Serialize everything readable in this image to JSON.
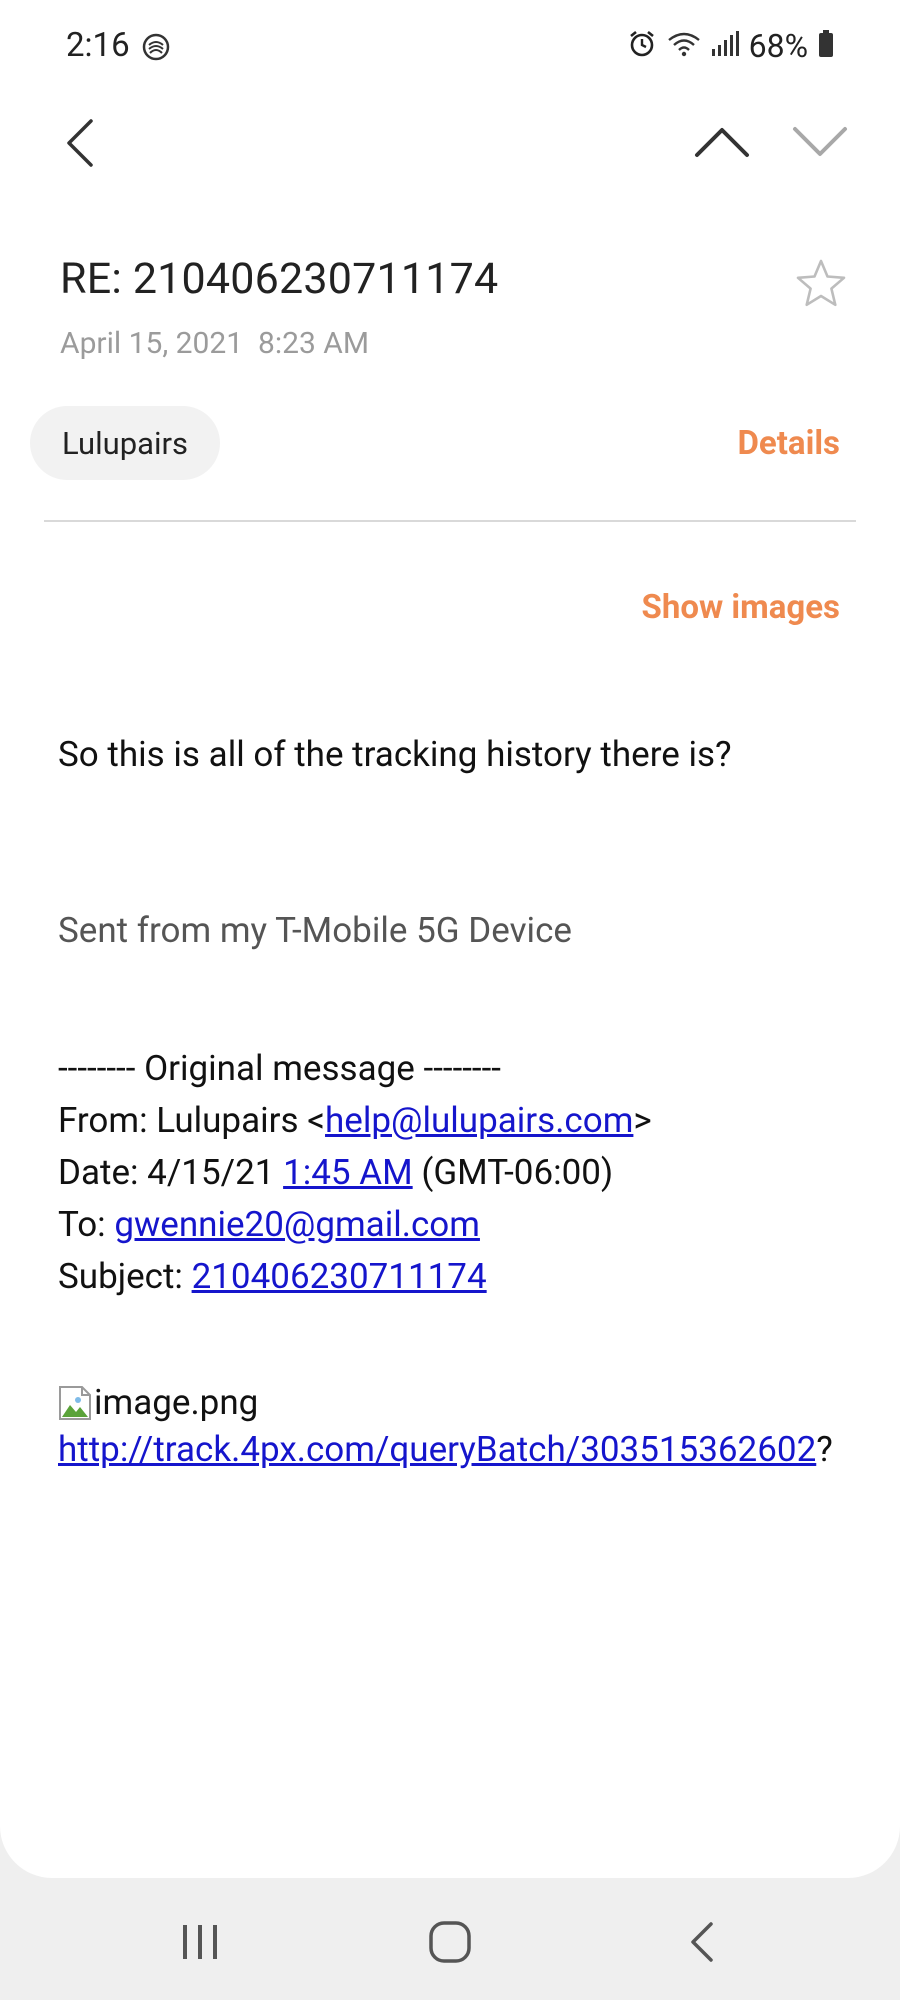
{
  "status_bar": {
    "time": "2:16",
    "battery_percent": "68%"
  },
  "toolbar": {
    "back_icon": "chevron-left-icon",
    "prev_icon": "chevron-up-icon",
    "next_icon": "chevron-down-icon"
  },
  "email": {
    "subject": "RE: 210406230711174",
    "date": "April 15, 2021  8:23 AM",
    "sender": "Lulupairs",
    "details_label": "Details",
    "show_images_label": "Show images",
    "body_line": "So this is all of the tracking history there is?",
    "signature": "Sent from my T-Mobile 5G Device",
    "original": {
      "header": "-------- Original message --------",
      "from_label": "From: Lulupairs <",
      "from_email": "help@lulupairs.com",
      "from_suffix": ">",
      "date_label": "Date: 4/15/21 ",
      "date_time": "1:45 AM",
      "date_suffix": " (GMT-06:00)",
      "to_label": "To: ",
      "to_email": "gwennie20@gmail.com",
      "subject_label": "Subject: ",
      "subject_value": "210406230711174"
    },
    "image_alt": "image.png",
    "tracking_url": "http://track.4px.com/queryBatch/303515362602",
    "tracking_suffix": "?"
  },
  "colors": {
    "accent": "#ef8a4f",
    "link": "#1515cc"
  }
}
